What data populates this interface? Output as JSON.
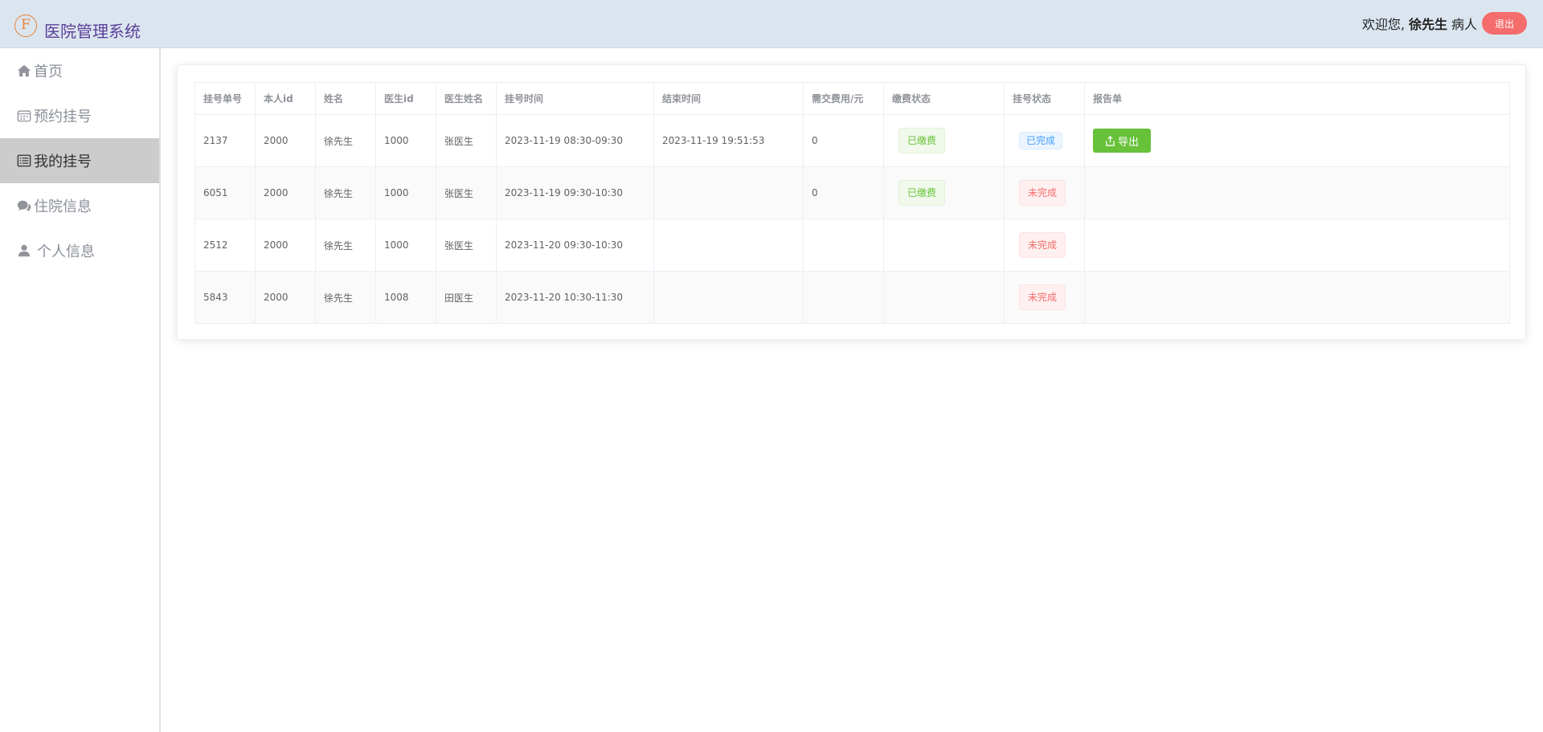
{
  "app": {
    "logo_letter": "F",
    "title": "医院管理系统"
  },
  "header": {
    "welcome": "欢迎您,",
    "user_name": "徐先生",
    "role": "病人",
    "logout_label": "退出"
  },
  "sidebar": {
    "items": [
      {
        "label": "首页",
        "icon": "home-icon",
        "active": false
      },
      {
        "label": "预约挂号",
        "icon": "calendar-icon",
        "active": false
      },
      {
        "label": "我的挂号",
        "icon": "list-icon",
        "active": true
      },
      {
        "label": "住院信息",
        "icon": "chat-icon",
        "active": false
      },
      {
        "label": "个人信息",
        "icon": "user-icon",
        "active": false
      }
    ]
  },
  "table": {
    "columns": [
      "挂号单号",
      "本人id",
      "姓名",
      "医生id",
      "医生姓名",
      "挂号时间",
      "结束时间",
      "需交费用/元",
      "缴费状态",
      "挂号状态",
      "报告单"
    ],
    "rows": [
      {
        "id": "2137",
        "patient_id": "2000",
        "name": "徐先生",
        "doctor_id": "1000",
        "doctor_name": "张医生",
        "time": "2023-11-19 08:30-09:30",
        "end_time": "2023-11-19 19:51:53",
        "fee": "0",
        "pay_status": "已缴费",
        "status": "已完成",
        "report": "导出"
      },
      {
        "id": "6051",
        "patient_id": "2000",
        "name": "徐先生",
        "doctor_id": "1000",
        "doctor_name": "张医生",
        "time": "2023-11-19 09:30-10:30",
        "end_time": "",
        "fee": "0",
        "pay_status": "已缴费",
        "status": "未完成",
        "report": ""
      },
      {
        "id": "2512",
        "patient_id": "2000",
        "name": "徐先生",
        "doctor_id": "1000",
        "doctor_name": "张医生",
        "time": "2023-11-20 09:30-10:30",
        "end_time": "",
        "fee": "",
        "pay_status": "",
        "status": "未完成",
        "report": ""
      },
      {
        "id": "5843",
        "patient_id": "2000",
        "name": "徐先生",
        "doctor_id": "1008",
        "doctor_name": "田医生",
        "time": "2023-11-20 10:30-11:30",
        "end_time": "",
        "fee": "",
        "pay_status": "",
        "status": "未完成",
        "report": ""
      }
    ]
  },
  "colors": {
    "header_bg": "#dbe5ef",
    "title": "#5b3f9a",
    "logout": "#f56c6c",
    "success": "#67c23a",
    "info": "#409eff",
    "danger": "#f56c6c",
    "active_menu": "#cccccc"
  }
}
